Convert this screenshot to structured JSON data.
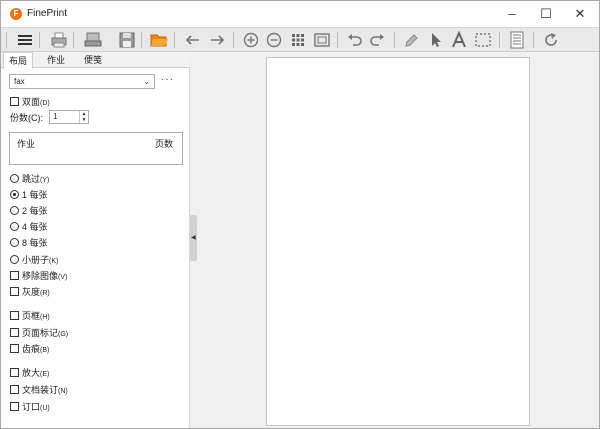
{
  "window": {
    "title": "FinePrint",
    "logo_letter": "F"
  },
  "controls": {
    "minimize": "–",
    "maximize": "☐",
    "close": "✕"
  },
  "toolbar": {
    "icons": [
      "menu-icon",
      "print-icon",
      "print-setup-icon",
      "save-icon",
      "open-folder-icon",
      "back-arrow-icon",
      "forward-arrow-icon",
      "zoom-in-icon",
      "zoom-out-icon",
      "grid-view-icon",
      "fit-page-icon",
      "undo-icon",
      "redo-icon",
      "edit-icon",
      "pointer-icon",
      "text-tool-icon",
      "select-tool-icon",
      "document-icon",
      "refresh-icon"
    ]
  },
  "tabs": [
    {
      "label": "布局",
      "active": true
    },
    {
      "label": "作业",
      "active": false
    },
    {
      "label": "便笺",
      "active": false
    }
  ],
  "form_selector": {
    "value": "fax",
    "more": "···"
  },
  "duplex": {
    "label": "双面",
    "key": "(D)",
    "checked": false
  },
  "copies": {
    "label": "份数(C):",
    "value": "1"
  },
  "job_table": {
    "col1": "作业",
    "col2": "页数"
  },
  "layout_options": [
    {
      "label": "跳过",
      "key": "(Y)",
      "selected": false
    },
    {
      "label": "1 每张",
      "key": "",
      "selected": true
    },
    {
      "label": "2 每张",
      "key": "",
      "selected": false
    },
    {
      "label": "4 每张",
      "key": "",
      "selected": false
    },
    {
      "label": "8 每张",
      "key": "",
      "selected": false
    },
    {
      "label": "小册子",
      "key": "(K)",
      "selected": false
    }
  ],
  "checkbox_group1": [
    {
      "label": "移除图像",
      "key": "(V)"
    },
    {
      "label": "灰度",
      "key": "(R)"
    }
  ],
  "checkbox_group2": [
    {
      "label": "页框",
      "key": "(H)"
    },
    {
      "label": "页面标记",
      "key": "(G)"
    },
    {
      "label": "齿痕",
      "key": "(B)"
    }
  ],
  "checkbox_group3": [
    {
      "label": "放大",
      "key": "(E)"
    },
    {
      "label": "文档装订",
      "key": "(N)"
    },
    {
      "label": "订口",
      "key": "(U)"
    }
  ]
}
